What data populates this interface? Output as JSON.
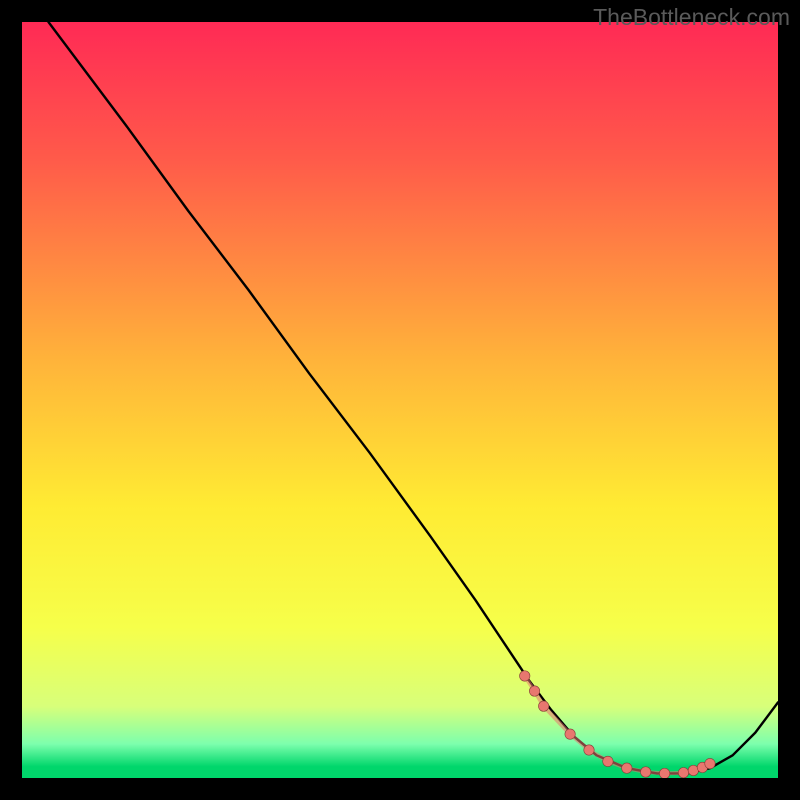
{
  "watermark": "TheBottleneck.com",
  "frame": {
    "outer_w": 800,
    "outer_h": 800,
    "pad": 22
  },
  "colors": {
    "gradient_top": "#ff2a55",
    "gradient_yellow": "#ffeb33",
    "gradient_green": "#00d66b",
    "curve": "#000000",
    "marker_fill": "#e8776f",
    "marker_stroke": "#863d38"
  },
  "chart_data": {
    "type": "line",
    "title": "",
    "xlabel": "",
    "ylabel": "",
    "xlim": [
      0,
      100
    ],
    "ylim": [
      0,
      100
    ],
    "grid": false,
    "legend": false,
    "gradient_stops": [
      {
        "pos": 0.0,
        "color": "#ff2a55"
      },
      {
        "pos": 0.18,
        "color": "#ff5a4a"
      },
      {
        "pos": 0.45,
        "color": "#ffb43a"
      },
      {
        "pos": 0.64,
        "color": "#ffeb33"
      },
      {
        "pos": 0.8,
        "color": "#f6ff4a"
      },
      {
        "pos": 0.905,
        "color": "#d8ff7a"
      },
      {
        "pos": 0.955,
        "color": "#7dffad"
      },
      {
        "pos": 0.985,
        "color": "#00d66b"
      },
      {
        "pos": 1.0,
        "color": "#00d66b"
      }
    ],
    "series": [
      {
        "name": "bottleneck-curve",
        "x": [
          3.5,
          8.0,
          14.0,
          22.0,
          30.0,
          38.0,
          46.0,
          54.0,
          60.0,
          64.0,
          67.0,
          70.0,
          73.0,
          76.0,
          80.0,
          84.0,
          88.0,
          91.0,
          94.0,
          97.0,
          100.0
        ],
        "y": [
          100.0,
          94.0,
          86.0,
          75.0,
          64.5,
          53.5,
          43.0,
          32.0,
          23.5,
          17.5,
          13.0,
          9.0,
          5.5,
          3.0,
          1.3,
          0.6,
          0.6,
          1.3,
          3.0,
          6.0,
          10.0
        ]
      }
    ],
    "markers": {
      "name": "optimum-range",
      "x": [
        66.5,
        67.8,
        69.0,
        72.5,
        75.0,
        77.5,
        80.0,
        82.5,
        85.0,
        87.5,
        88.8,
        90.0,
        91.0
      ],
      "y": [
        13.5,
        11.5,
        9.5,
        5.8,
        3.7,
        2.2,
        1.3,
        0.8,
        0.6,
        0.7,
        1.0,
        1.4,
        1.9
      ]
    }
  }
}
